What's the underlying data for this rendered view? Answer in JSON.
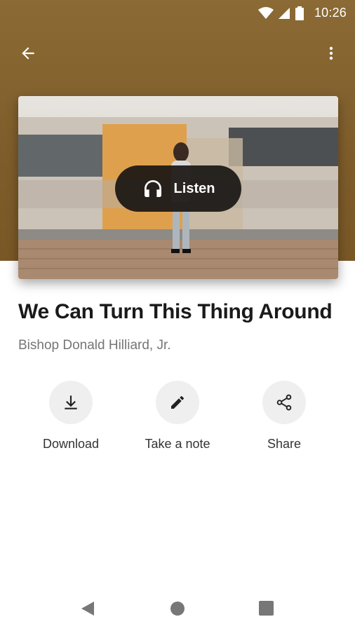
{
  "status_bar": {
    "time": "10:26"
  },
  "colors": {
    "header_bg": "#7f5d2b",
    "accent_dark": "#1a1a1a"
  },
  "episode": {
    "title": "We Can Turn This Thing Around",
    "author": "Bishop Donald Hilliard, Jr.",
    "listen_label": "Listen"
  },
  "actions": [
    {
      "label": "Download",
      "icon": "download-icon"
    },
    {
      "label": "Take a note",
      "icon": "pencil-icon"
    },
    {
      "label": "Share",
      "icon": "share-icon"
    }
  ]
}
